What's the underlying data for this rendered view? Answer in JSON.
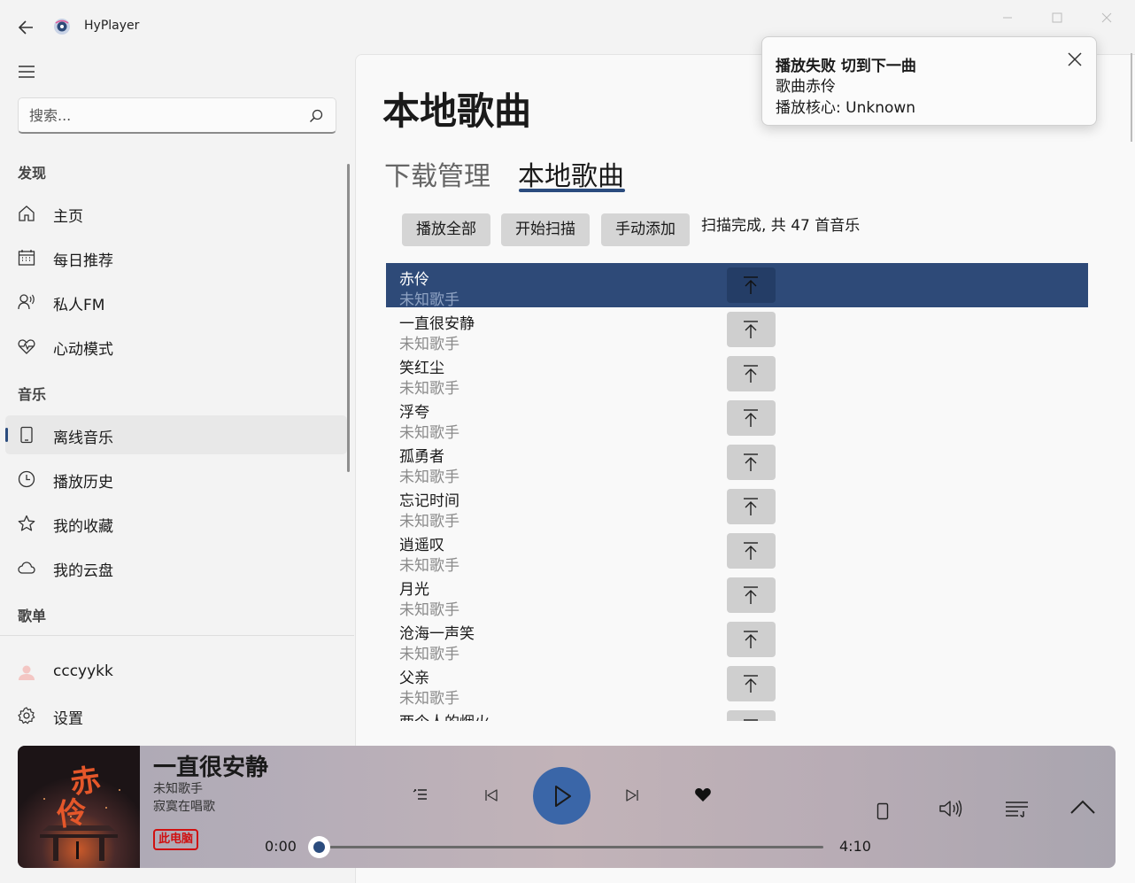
{
  "app": {
    "title": "HyPlayer"
  },
  "search": {
    "placeholder": "搜索..."
  },
  "sidebar": {
    "sections": {
      "discover": "发现",
      "music": "音乐",
      "playlists": "歌单"
    },
    "discover_items": [
      {
        "label": "主页",
        "icon": "home-icon"
      },
      {
        "label": "每日推荐",
        "icon": "calendar-icon"
      },
      {
        "label": "私人FM",
        "icon": "radio-person-icon"
      },
      {
        "label": "心动模式",
        "icon": "heartbeat-icon"
      }
    ],
    "music_items": [
      {
        "label": "离线音乐",
        "icon": "device-icon",
        "selected": true
      },
      {
        "label": "播放历史",
        "icon": "clock-icon"
      },
      {
        "label": "我的收藏",
        "icon": "star-icon"
      },
      {
        "label": "我的云盘",
        "icon": "cloud-icon"
      }
    ],
    "user": {
      "label": "cccyykk",
      "icon": "avatar-icon"
    },
    "settings": {
      "label": "设置",
      "icon": "gear-icon"
    }
  },
  "main": {
    "title": "本地歌曲",
    "tabs": [
      {
        "label": "下载管理",
        "active": false
      },
      {
        "label": "本地歌曲",
        "active": true
      }
    ],
    "actions": {
      "play_all": "播放全部",
      "scan": "开始扫描",
      "manual_add": "手动添加"
    },
    "scan_status": "扫描完成, 共 47 首音乐",
    "songs": [
      {
        "title": "赤伶",
        "artist": "未知歌手",
        "active": true
      },
      {
        "title": "一直很安静",
        "artist": "未知歌手"
      },
      {
        "title": "笑红尘",
        "artist": "未知歌手"
      },
      {
        "title": "浮夸",
        "artist": "未知歌手"
      },
      {
        "title": "孤勇者",
        "artist": "未知歌手"
      },
      {
        "title": "忘记时间",
        "artist": "未知歌手"
      },
      {
        "title": "逍遥叹",
        "artist": "未知歌手"
      },
      {
        "title": "月光",
        "artist": "未知歌手"
      },
      {
        "title": "沧海一声笑",
        "artist": "未知歌手"
      },
      {
        "title": "父亲",
        "artist": "未知歌手"
      },
      {
        "title": "两个人的烟火",
        "artist": ""
      }
    ]
  },
  "toast": {
    "title": "播放失败 切到下一曲",
    "song_line": "歌曲赤伶",
    "core_line": "播放核心:   Unknown"
  },
  "player": {
    "title": "一直很安静",
    "artist": "未知歌手",
    "album": "寂寞在唱歌",
    "source_badge": "此电脑",
    "current_time": "0:00",
    "total_time": "4:10",
    "progress": 0.0,
    "cover_text": "赤伶",
    "accent": "#2b4c7e",
    "play_color": "#3a66a8"
  }
}
